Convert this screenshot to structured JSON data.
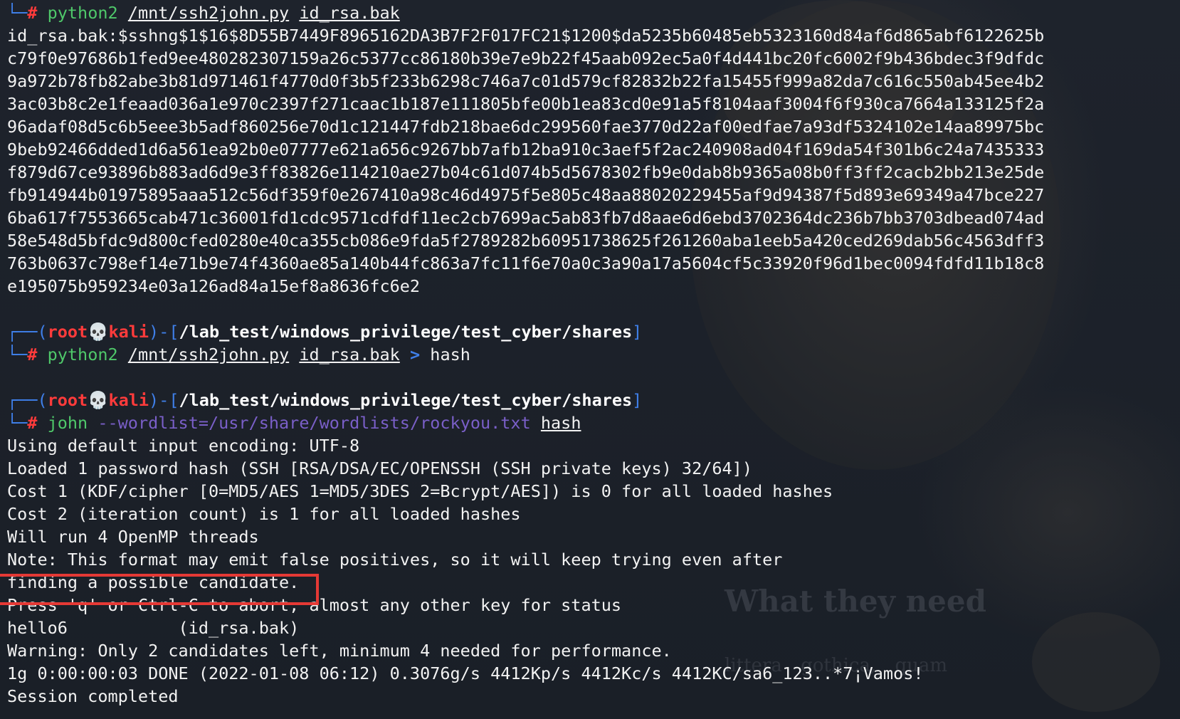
{
  "background": {
    "heading": "What they need",
    "subtext": "littera gothica, quam"
  },
  "prompt": {
    "user": "root",
    "skull": "💀",
    "host": "kali",
    "path": "/lab_test/windows_privilege/test_cyber/shares",
    "symbol": "#"
  },
  "commands": [
    {
      "cmd": "python2",
      "script": "/mnt/ssh2john.py",
      "arg": "id_rsa.bak"
    },
    {
      "cmd": "python2",
      "script": "/mnt/ssh2john.py",
      "arg": "id_rsa.bak",
      "redirect": ">",
      "target": "hash"
    },
    {
      "cmd": "john",
      "option": "--wordlist=/usr/share/wordlists/rockyou.txt",
      "arg": "hash"
    }
  ],
  "hash_output": [
    "id_rsa.bak:$sshng$1$16$8D55B7449F8965162DA3B7F2F017FC21$1200$da5235b60485eb5323160d84af6d865abf6122625b",
    "c79f0e97686b1fed9ee480282307159a26c5377cc86180b39e7e9b22f45aab092ec5a0f4d441bc20fc6002f9b436bdec3f9dfdc",
    "9a972b78fb82abe3b81d971461f4770d0f3b5f233b6298c746a7c01d579cf82832b22fa15455f999a82da7c616c550ab45ee4b2",
    "3ac03b8c2e1feaad036a1e970c2397f271caac1b187e111805bfe00b1ea83cd0e91a5f8104aaf3004f6f930ca7664a133125f2a",
    "96adaf08d5c6b5eee3b5adf860256e70d1c121447fdb218bae6dc299560fae3770d22af00edfae7a93df5324102e14aa89975bc",
    "9beb92466dded1d6a561ea92b0e07777e621a656c9267bb7afb12ba910c3aef5f2ac240908ad04f169da54f301b6c24a7435333",
    "f879d67ce93896b883ad6d9e3ff83826e114210ae27b04c61d074b5d5678302fb9e0dab8b9365a08b0ff3ff2cacb2bb213e25de",
    "fb914944b01975895aaa512c56df359f0e267410a98c46d4975f5e805c48aa88020229455af9d94387f5d893e69349a47bce227",
    "6ba617f7553665cab471c36001fd1cdc9571cdfdf11ec2cb7699ac5ab83fb7d8aae6d6ebd3702364dc236b7bb3703dbead074ad",
    "58e548d5bfdc9d800cfed0280e40ca355cb086e9fda5f2789282b60951738625f261260aba1eeb5a420ced269dab56c4563dff3",
    "763b0637c798ef14e71b9e74f4360ae85a140b44fc863a7fc11f6e70a0c3a90a17a5604cf5c33920f96d1bec0094fdfd11b18c8",
    "e195075b959234e03a126ad84a15ef8a8636fc6e2"
  ],
  "john_output": [
    "Using default input encoding: UTF-8",
    "Loaded 1 password hash (SSH [RSA/DSA/EC/OPENSSH (SSH private keys) 32/64])",
    "Cost 1 (KDF/cipher [0=MD5/AES 1=MD5/3DES 2=Bcrypt/AES]) is 0 for all loaded hashes",
    "Cost 2 (iteration count) is 1 for all loaded hashes",
    "Will run 4 OpenMP threads",
    "Note: This format may emit false positives, so it will keep trying even after",
    "finding a possible candidate.",
    "Press 'q' or Ctrl-C to abort, almost any other key for status",
    "hello6           (id_rsa.bak)",
    "Warning: Only 2 candidates left, minimum 4 needed for performance.",
    "1g 0:00:00:03 DONE (2022-01-08 06:12) 0.3076g/s 4412Kp/s 4412Kc/s 4412KC/sa6_123..*7¡Vamos!",
    "Session completed"
  ],
  "colors": {
    "background": "#1d222b",
    "prompt_frame": "#3f7fe8",
    "prompt_user": "#ff3b3b",
    "command": "#4fc86a",
    "option": "#7a5fc8",
    "highlight": "#e53935"
  }
}
